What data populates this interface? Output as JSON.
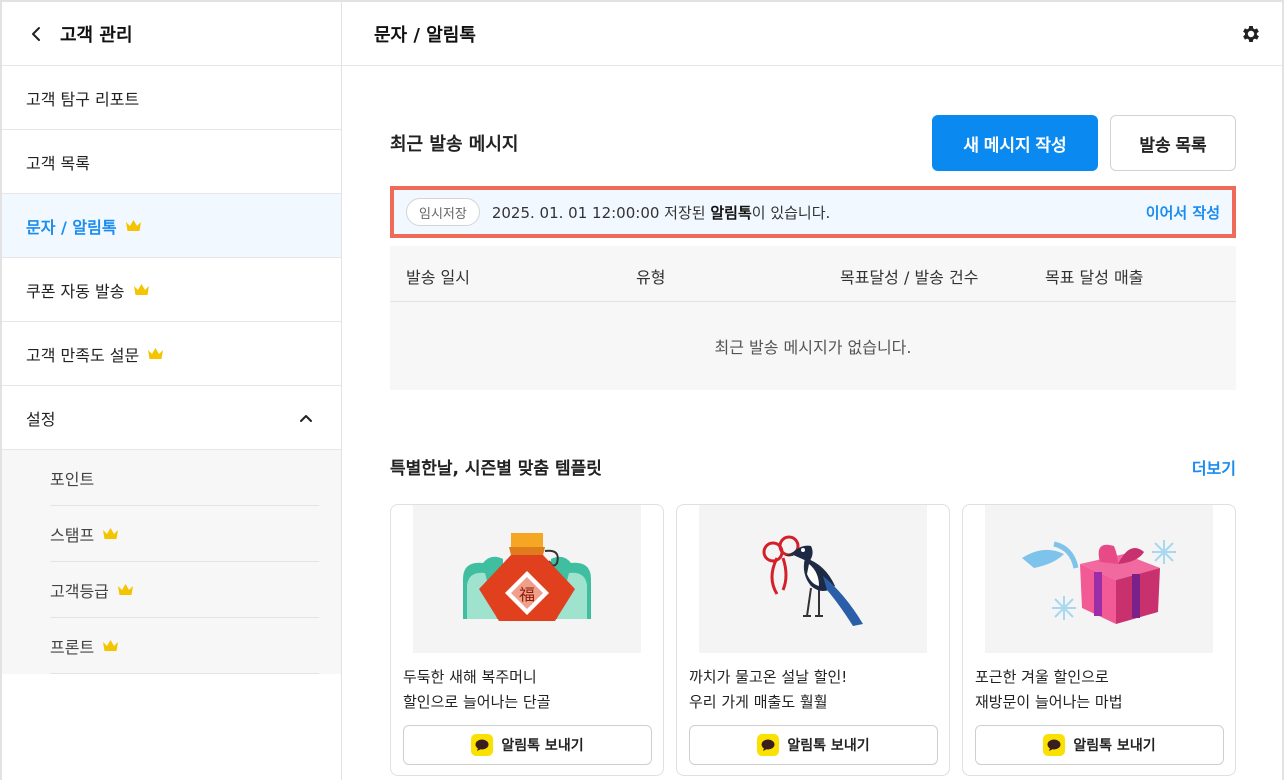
{
  "sidebar": {
    "title": "고객 관리",
    "items": [
      {
        "label": "고객 탐구 리포트",
        "premium": false
      },
      {
        "label": "고객 목록",
        "premium": false
      },
      {
        "label": "문자 / 알림톡",
        "premium": true
      },
      {
        "label": "쿠폰 자동 발송",
        "premium": true
      },
      {
        "label": "고객 만족도 설문",
        "premium": true
      }
    ],
    "settings_label": "설정",
    "sub_items": [
      {
        "label": "포인트",
        "premium": false
      },
      {
        "label": "스탬프",
        "premium": true
      },
      {
        "label": "고객등급",
        "premium": true
      },
      {
        "label": "프론트",
        "premium": true
      }
    ]
  },
  "header": {
    "title": "문자 / 알림톡"
  },
  "recent": {
    "title": "최근 발송 메시지",
    "new_button": "새 메시지 작성",
    "list_button": "발송 목록"
  },
  "draft": {
    "badge": "임시저장",
    "text_before": "2025. 01. 01 12:00:00 저장된 ",
    "text_bold": "알림톡",
    "text_after": "이 있습니다.",
    "link": "이어서 작성"
  },
  "table": {
    "columns": [
      "발송 일시",
      "유형",
      "목표달성 / 발송 건수",
      "목표 달성 매출"
    ],
    "empty": "최근 발송 메시지가 없습니다."
  },
  "templates": {
    "title": "특별한날, 시즌별 맞춤 템플릿",
    "more": "더보기",
    "cards": [
      {
        "line1": "두둑한 새해 복주머니",
        "line2": "할인으로 늘어나는 단골",
        "button": "알림톡 보내기",
        "image": "lucky-pouch-image",
        "glyph": "福"
      },
      {
        "line1": "까치가 물고온 설날 할인!",
        "line2": "우리 가게 매출도 훨훨",
        "button": "알림톡 보내기",
        "image": "magpie-image"
      },
      {
        "line1": "포근한 겨울 할인으로",
        "line2": "재방문이 늘어나는 마법",
        "button": "알림톡 보내기",
        "image": "gift-box-image"
      }
    ]
  },
  "colors": {
    "accent": "#0a8af0",
    "highlight_border": "#f06a5a",
    "kakao": "#fae100",
    "crown": "#f5c400"
  }
}
